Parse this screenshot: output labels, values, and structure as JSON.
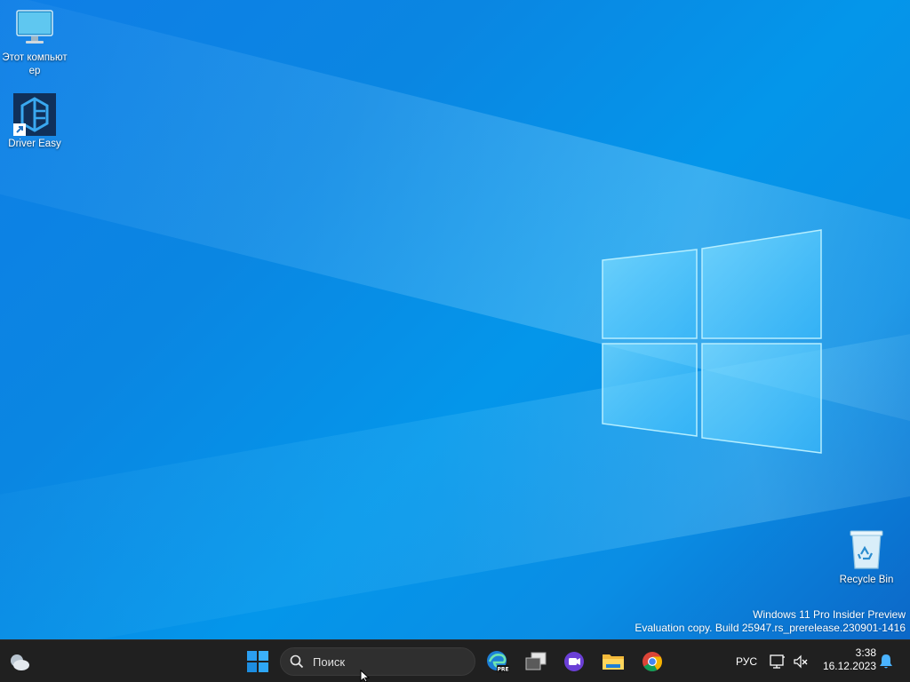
{
  "desktop": {
    "icons": [
      {
        "label": "Этот компьютер",
        "icon": "this-pc-icon"
      },
      {
        "label": "Driver Easy",
        "icon": "driver-easy-icon"
      },
      {
        "label": "Recycle Bin",
        "icon": "recycle-bin-icon"
      }
    ],
    "watermark": {
      "line1": "Windows 11 Pro Insider Preview",
      "line2": "Evaluation copy. Build 25947.rs_prerelease.230901-1416"
    }
  },
  "taskbar": {
    "weather_icon": "weather-cloud-icon",
    "start_icon": "windows-start-icon",
    "search": {
      "placeholder": "Поиск"
    },
    "apps": [
      {
        "name": "Microsoft Edge Preview",
        "icon": "edge-pre-icon"
      },
      {
        "name": "Task View",
        "icon": "task-view-icon"
      },
      {
        "name": "Clipchamp",
        "icon": "clipchamp-icon"
      },
      {
        "name": "File Explorer",
        "icon": "file-explorer-icon"
      },
      {
        "name": "Google Chrome",
        "icon": "chrome-icon"
      }
    ],
    "tray": {
      "language": "РУС",
      "time": "3:38",
      "date": "16.12.2023"
    }
  },
  "colors": {
    "accent": "#0078d4",
    "taskbar_bg": "#202020",
    "desktop_blue": "#0a8de4"
  }
}
